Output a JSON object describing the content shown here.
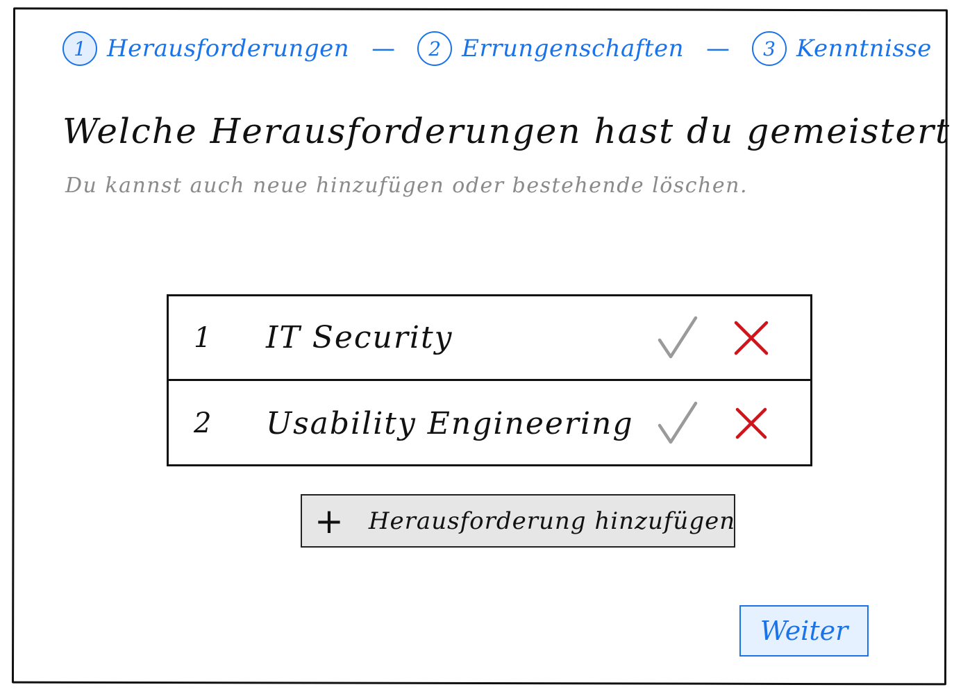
{
  "stepper": {
    "steps": [
      {
        "number": "1",
        "label": "Herausforderungen"
      },
      {
        "number": "2",
        "label": "Errungenschaften"
      },
      {
        "number": "3",
        "label": "Kenntnisse"
      }
    ],
    "separator": "—",
    "active_step": 1
  },
  "page": {
    "title": "Welche Herausforderungen hast du gemeistert?",
    "subtitle": "Du kannst auch neue hinzufügen oder bestehende löschen."
  },
  "challenges": [
    {
      "number": "1",
      "label": "IT Security",
      "confirm_icon": "check-icon",
      "delete_icon": "close-icon"
    },
    {
      "number": "2",
      "label": "Usability Engineering",
      "confirm_icon": "check-icon",
      "delete_icon": "close-icon"
    }
  ],
  "add_button": {
    "icon": "plus-icon",
    "label": "Herausforderung hinzufügen"
  },
  "next_button": {
    "label": "Weiter"
  },
  "colors": {
    "accent": "#1a73e8",
    "check": "#9a9a9a",
    "delete": "#d0141c",
    "button_bg": "#e6e6e6"
  }
}
